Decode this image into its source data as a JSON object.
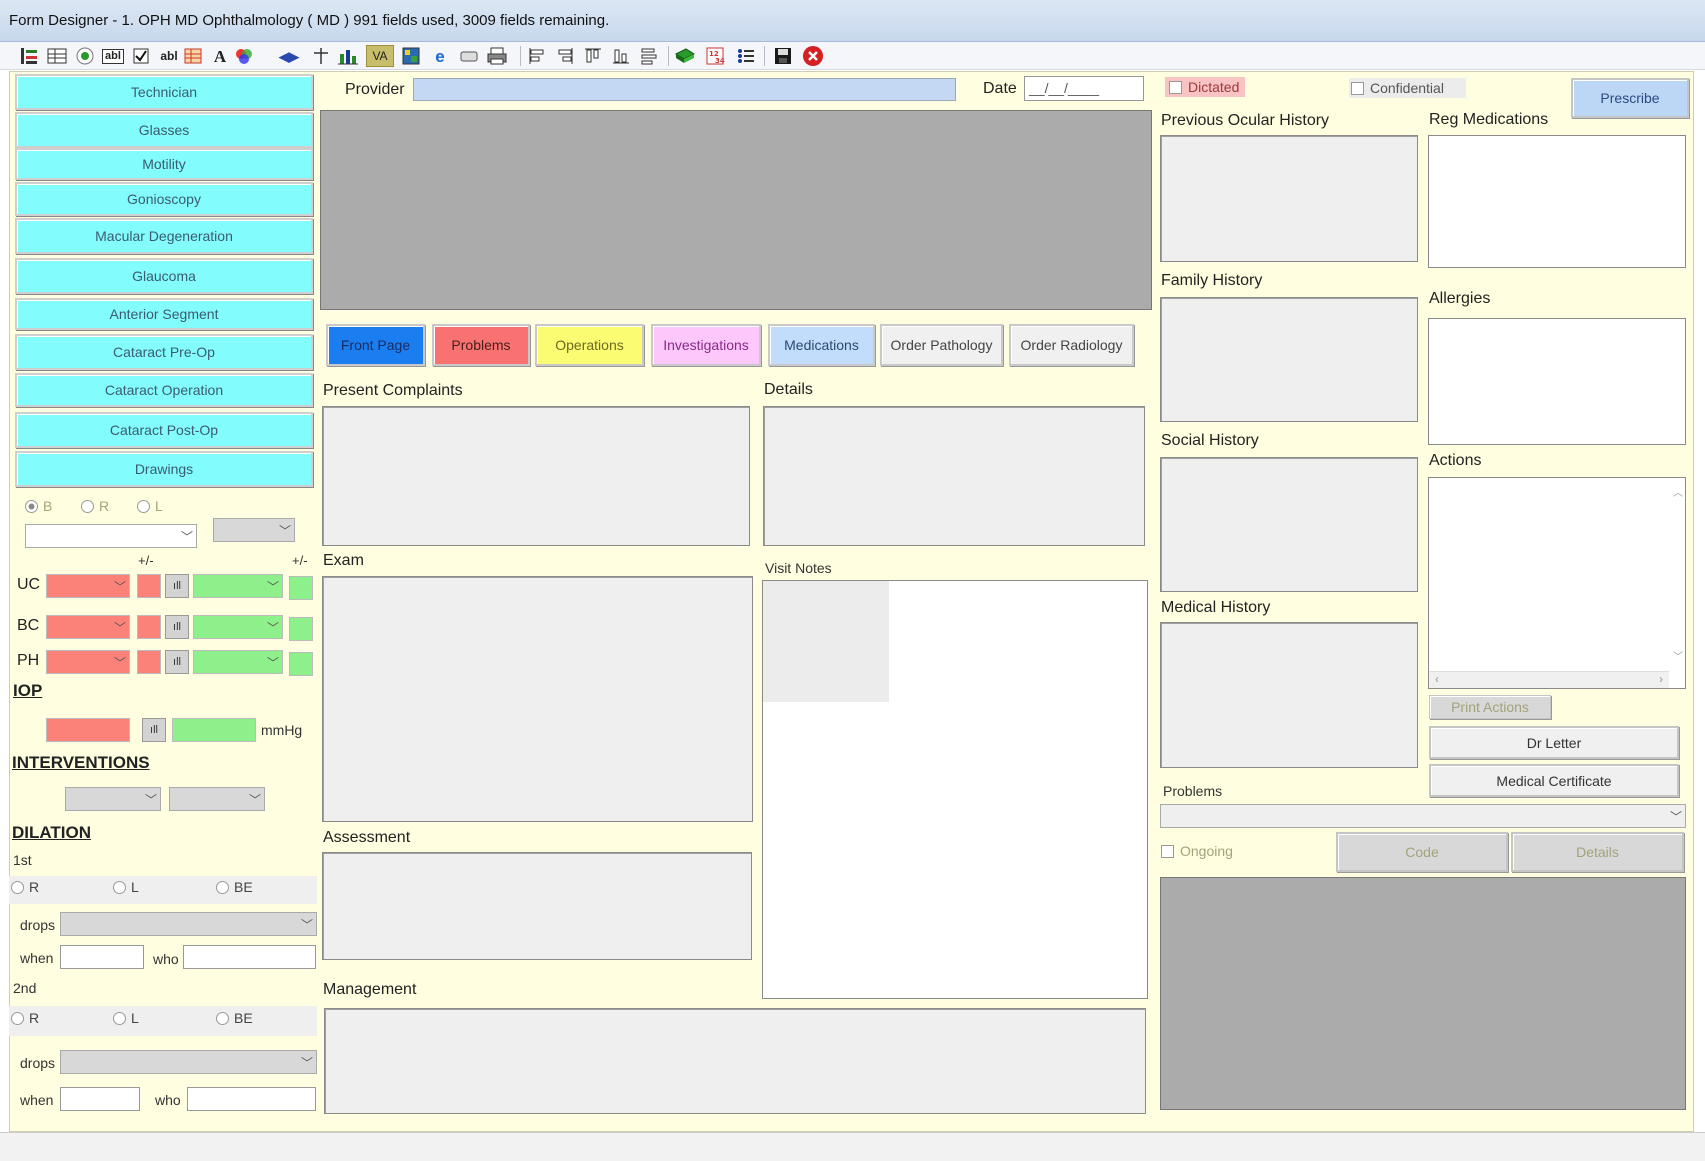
{
  "window": {
    "title": "Form Designer - 1. OPH MD Ophthalmology ( MD ) 991 fields used, 3009 fields remaining."
  },
  "toolbar": {
    "va_label": "VA",
    "icons": [
      "tree-icon",
      "grid-icon",
      "radio-icon",
      "textbox-icon",
      "checkbox-icon",
      "label-icon",
      "table-icon",
      "font-icon",
      "colors-icon",
      "arrows-icon",
      "line-icon",
      "chart-icon",
      "va-icon",
      "image-icon",
      "ie-icon",
      "button-icon",
      "print-icon",
      "align-left-icon",
      "align-right-icon",
      "align-top-icon",
      "align-bottom-icon",
      "distribute-icon",
      "book-icon",
      "calculator-icon",
      "list-icon",
      "save-icon",
      "close-icon"
    ]
  },
  "sidebar": {
    "buttons": [
      "Technician",
      "Glasses",
      "Motility",
      "Gonioscopy",
      "Macular Degeneration",
      "Glaucoma",
      "Anterior Segment",
      "Cataract Pre-Op",
      "Cataract Operation",
      "Cataract Post-Op",
      "Drawings"
    ],
    "eye_radios": [
      "B",
      "R",
      "L"
    ],
    "pm_label": "+/-",
    "va_rows": [
      "UC",
      "BC",
      "PH"
    ],
    "iop_header": "IOP",
    "mmhg_label": "mmHg",
    "interventions_header": "INTERVENTIONS",
    "dilation_header": "DILATION",
    "first_label": "1st",
    "second_label": "2nd",
    "dil_radios": [
      "R",
      "L",
      "BE"
    ],
    "drops_label": "drops",
    "when_label": "when",
    "who_label": "who"
  },
  "header": {
    "provider_label": "Provider",
    "date_label": "Date",
    "date_value": "__/__/____",
    "dictated_label": "Dictated",
    "confidential_label": "Confidential",
    "prescribe_label": "Prescribe"
  },
  "tabs": [
    {
      "label": "Front Page",
      "bg": "#1a7ef0",
      "fg": "#1c2a5e"
    },
    {
      "label": "Problems",
      "bg": "#f87272",
      "fg": "#4a1c1c"
    },
    {
      "label": "Operations",
      "bg": "#fcfc72",
      "fg": "#6a6a20"
    },
    {
      "label": "Investigations",
      "bg": "#fcc8fc",
      "fg": "#8a2a8a"
    },
    {
      "label": "Medications",
      "bg": "#c2dcfc",
      "fg": "#2c4a70"
    },
    {
      "label": "Order Pathology",
      "bg": "#f0f0f0",
      "fg": "#444444"
    },
    {
      "label": "Order Radiology",
      "bg": "#f0f0f0",
      "fg": "#444444"
    }
  ],
  "main": {
    "present_complaints": "Present Complaints",
    "details": "Details",
    "exam": "Exam",
    "visit_notes": "Visit Notes",
    "assessment": "Assessment",
    "management": "Management"
  },
  "history": {
    "previous_ocular": "Previous Ocular History",
    "family": "Family History",
    "social": "Social History",
    "medical": "Medical History",
    "problems": "Problems",
    "ongoing": "Ongoing",
    "code": "Code",
    "details": "Details"
  },
  "right": {
    "reg_medications": "Reg Medications",
    "allergies": "Allergies",
    "actions": "Actions",
    "print_actions": "Print Actions",
    "dr_letter": "Dr Letter",
    "medical_certificate": "Medical Certificate"
  }
}
